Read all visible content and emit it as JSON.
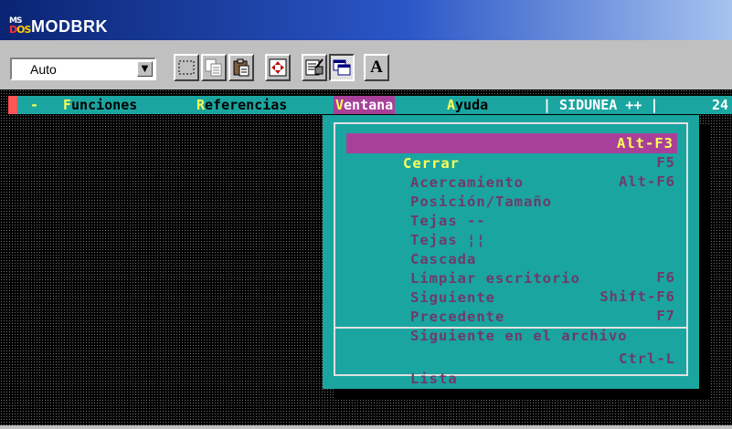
{
  "window": {
    "title": "MODBRK",
    "logo_ms": "MS",
    "logo_dos_d": "D",
    "logo_dos_os": "OS"
  },
  "toolbar": {
    "font_size_value": "Auto",
    "buttons": [
      {
        "name": "mark-icon"
      },
      {
        "name": "copy-icon"
      },
      {
        "name": "paste-icon"
      },
      {
        "name": "fullscreen-icon"
      },
      {
        "name": "properties-icon"
      },
      {
        "name": "background-icon"
      },
      {
        "name": "font-icon",
        "label": "A"
      }
    ]
  },
  "menubar": {
    "system": "-",
    "funciones_hot": "F",
    "funciones_rest": "unciones",
    "referencias_hot": "R",
    "referencias_rest": "eferencias",
    "ventana_hot": "V",
    "ventana_rest": "entana",
    "ayuda_hot": "A",
    "ayuda_rest": "yuda",
    "sidunea": "| SIDUNEA ++ |",
    "clock": "24"
  },
  "menu": {
    "items": [
      {
        "label": "Cerrar",
        "shortcut": "Alt-F3",
        "selected": true
      },
      {
        "label": "Acercamiento",
        "shortcut": "F5"
      },
      {
        "label": "Posición/Tamaño",
        "shortcut": "Alt-F6"
      },
      {
        "label": "Tejas --",
        "shortcut": ""
      },
      {
        "label": "Tejas ¦¦",
        "shortcut": ""
      },
      {
        "label": "Cascada",
        "shortcut": ""
      },
      {
        "label": "Limpiar escritorio",
        "shortcut": ""
      },
      {
        "label": "Siguiente",
        "shortcut": "F6"
      },
      {
        "label": "Precedente",
        "shortcut": "Shift-F6"
      },
      {
        "label": "Siguiente en el archivo",
        "shortcut": "F7"
      },
      {
        "label": "Lista",
        "shortcut": "Ctrl-L"
      }
    ]
  },
  "colors": {
    "dos_cyan": "#1aa5a0",
    "dos_magenta": "#a8409a",
    "dos_yellow": "#ffff55",
    "disabled_text": "#6f3a6a"
  }
}
